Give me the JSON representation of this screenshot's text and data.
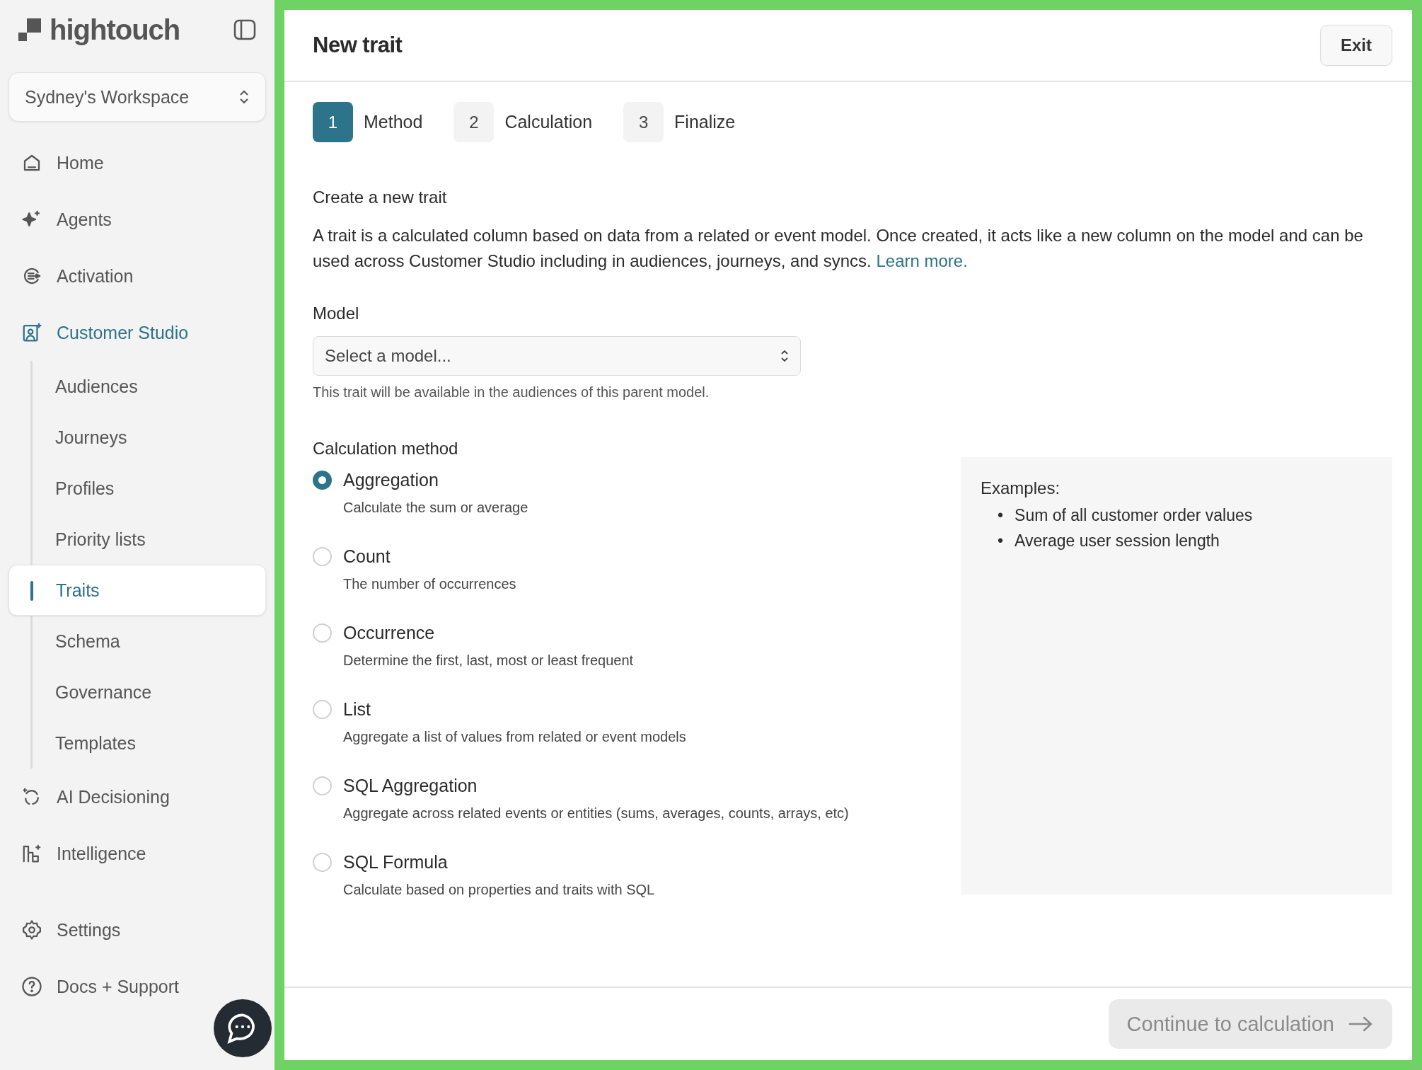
{
  "sidebar": {
    "logo": "hightouch",
    "workspace": "Sydney's Workspace",
    "nav": [
      {
        "label": "Home",
        "active": false
      },
      {
        "label": "Agents",
        "active": false
      },
      {
        "label": "Activation",
        "active": false
      },
      {
        "label": "Customer Studio",
        "active": true,
        "children": [
          {
            "label": "Audiences",
            "selected": false
          },
          {
            "label": "Journeys",
            "selected": false
          },
          {
            "label": "Profiles",
            "selected": false
          },
          {
            "label": "Priority lists",
            "selected": false
          },
          {
            "label": "Traits",
            "selected": true
          },
          {
            "label": "Schema",
            "selected": false
          },
          {
            "label": "Governance",
            "selected": false
          },
          {
            "label": "Templates",
            "selected": false
          }
        ]
      },
      {
        "label": "AI Decisioning",
        "active": false
      },
      {
        "label": "Intelligence",
        "active": false
      }
    ],
    "footer_nav": [
      {
        "label": "Settings"
      },
      {
        "label": "Docs + Support"
      }
    ]
  },
  "main": {
    "title": "New trait",
    "exit_button": "Exit",
    "steps": [
      {
        "number": "1",
        "label": "Method",
        "selected": true
      },
      {
        "number": "2",
        "label": "Calculation",
        "selected": false
      },
      {
        "number": "3",
        "label": "Finalize",
        "selected": false
      }
    ],
    "intro": {
      "heading": "Create a new trait",
      "text": "A trait is a calculated column based on data from a related or event model. Once created, it acts like a new column on the model and can be used across Customer Studio including in audiences, journeys, and syncs.",
      "link": "Learn more."
    },
    "model": {
      "label": "Model",
      "placeholder": "Select a model...",
      "hint": "This trait will be available in the audiences of this parent model."
    },
    "method": {
      "label": "Calculation method",
      "options": [
        {
          "label": "Aggregation",
          "description": "Calculate the sum or average",
          "selected": true
        },
        {
          "label": "Count",
          "description": "The number of occurrences",
          "selected": false
        },
        {
          "label": "Occurrence",
          "description": "Determine the first, last, most or least frequent",
          "selected": false
        },
        {
          "label": "List",
          "description": "Aggregate a list of values from related or event models",
          "selected": false
        },
        {
          "label": "SQL Aggregation",
          "description": "Aggregate across related events or entities (sums, averages, counts, arrays, etc)",
          "selected": false
        },
        {
          "label": "SQL Formula",
          "description": "Calculate based on properties and traits with SQL",
          "selected": false
        }
      ]
    },
    "examples": {
      "title": "Examples:",
      "items": [
        {
          "bullet": "•",
          "text": "Sum of all customer order values"
        },
        {
          "bullet": "•",
          "text": "Average user session length"
        }
      ]
    },
    "continue_button": {
      "label": "Continue to calculation",
      "disabled": true
    }
  }
}
